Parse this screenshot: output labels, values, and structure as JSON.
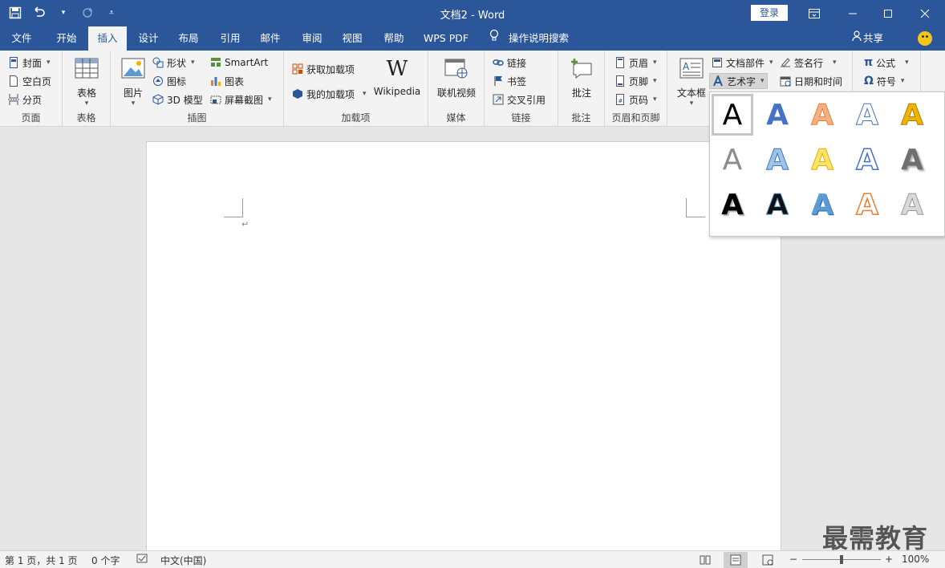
{
  "titlebar": {
    "doc_title": "文档2 - Word",
    "signin_label": "登录"
  },
  "tabs": [
    {
      "label": "文件"
    },
    {
      "label": "开始"
    },
    {
      "label": "插入"
    },
    {
      "label": "设计"
    },
    {
      "label": "布局"
    },
    {
      "label": "引用"
    },
    {
      "label": "邮件"
    },
    {
      "label": "审阅"
    },
    {
      "label": "视图"
    },
    {
      "label": "帮助"
    },
    {
      "label": "WPS PDF"
    }
  ],
  "active_tab": "插入",
  "tell_me": "操作说明搜索",
  "share_label": "共享",
  "ribbon": {
    "pages": {
      "cover": "封面",
      "blank": "空白页",
      "break": "分页",
      "label": "页面"
    },
    "tables": {
      "table": "表格",
      "label": "表格"
    },
    "illustrations": {
      "pictures": "图片",
      "shapes": "形状",
      "icons": "图标",
      "models3d": "3D 模型",
      "smartart": "SmartArt",
      "chart": "图表",
      "screenshot": "屏幕截图",
      "label": "插图"
    },
    "addins": {
      "get": "获取加载项",
      "mine": "我的加载项",
      "wikipedia": "Wikipedia",
      "label": "加载项"
    },
    "media": {
      "video": "联机视频",
      "label": "媒体"
    },
    "links": {
      "link": "链接",
      "bookmark": "书签",
      "crossref": "交叉引用",
      "label": "链接"
    },
    "comments": {
      "comment": "批注",
      "label": "批注"
    },
    "header_footer": {
      "header": "页眉",
      "footer": "页脚",
      "page_number": "页码",
      "label": "页眉和页脚"
    },
    "text": {
      "textbox": "文本框",
      "quick_parts": "文档部件",
      "wordart": "艺术字",
      "signature": "签名行",
      "datetime": "日期和时间"
    },
    "symbols": {
      "equation": "公式",
      "symbol": "符号"
    }
  },
  "wordart_gallery": {
    "glyph": "A",
    "styles": [
      "fill-black",
      "fill-blue-outline",
      "fill-orange-outline",
      "outline-blue",
      "fill-gold",
      "fill-gray",
      "gradient-blue-reflect",
      "fill-yellow-outline",
      "outline-blue-double",
      "fill-gray-shadow",
      "fill-black-shadow",
      "fill-black-outline-blue",
      "fill-blue-bevel",
      "outline-orange",
      "fill-silver"
    ],
    "colors": {
      "blue": "#4472c4",
      "orange": "#ed7d31",
      "gold": "#f0b400",
      "gray": "#8c8c8c"
    }
  },
  "document": {
    "paragraph_mark": "↵"
  },
  "watermark": "最需教育",
  "statusbar": {
    "page_info": "第 1 页，共 1 页",
    "word_count": "0 个字",
    "language": "中文(中国)",
    "zoom": "100%",
    "zoom_fraction": 0.5
  },
  "theme": {
    "accent": "#2b579a"
  }
}
